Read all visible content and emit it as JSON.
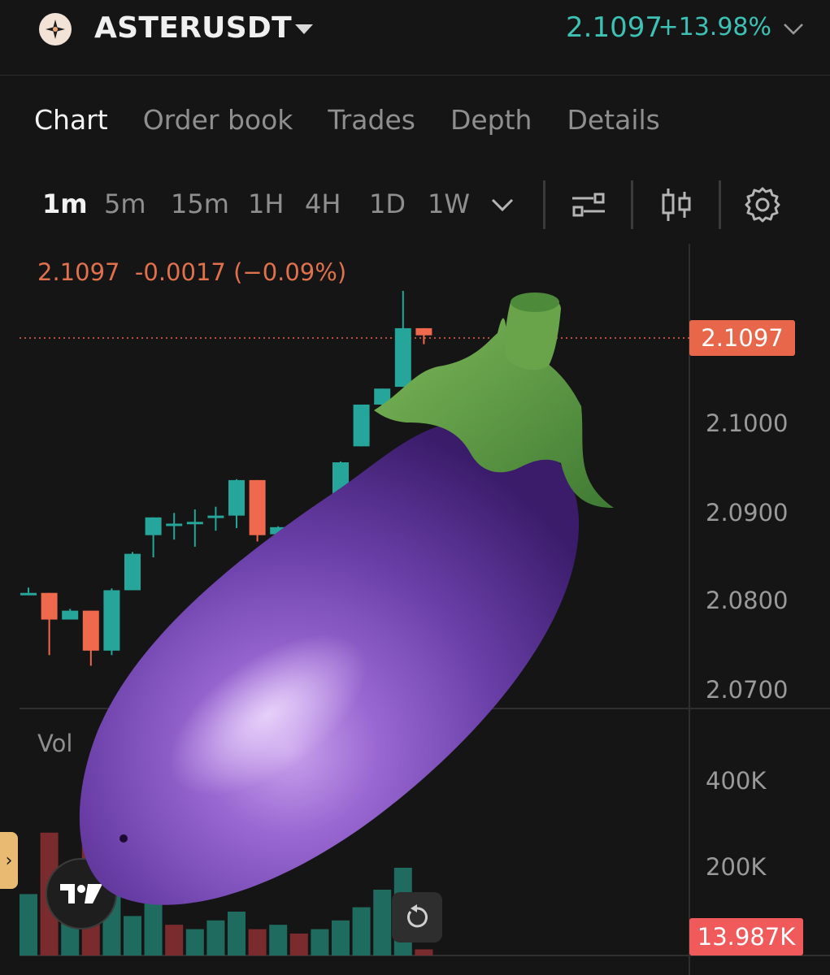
{
  "header": {
    "pair": "ASTERUSDT",
    "price": "2.1097",
    "change": "+13.98%"
  },
  "tabs": [
    "Chart",
    "Order book",
    "Trades",
    "Depth",
    "Details"
  ],
  "intervals": [
    "1m",
    "5m",
    "15m",
    "1H",
    "4H",
    "1D",
    "1W"
  ],
  "chart": {
    "ohlc_price": "2.1097",
    "ohlc_change": "-0.0017 (−0.09%)",
    "last_price_tag": "2.1097",
    "y_ticks": [
      "2.1000",
      "2.0900",
      "2.0800",
      "2.0700"
    ],
    "volume_label": "Vol",
    "volume_ticks": [
      "400K",
      "200K"
    ],
    "volume_tag": "13.987K"
  },
  "colors": {
    "up": "#26a69a",
    "down": "#ef6a4c",
    "accent_teal": "#3ec1b5"
  },
  "icons": {
    "logo": "aster-logo",
    "caret": "caret-down-icon",
    "indicators": "indicators-icon",
    "candles": "candlestick-icon",
    "settings": "gear-icon",
    "tradingview": "tradingview-logo",
    "reset": "reset-icon",
    "overlay": "eggplant-emoji"
  },
  "chart_data": {
    "type": "candlestick",
    "interval": "1m",
    "candles": [
      {
        "o": 2.081,
        "h": 2.0816,
        "l": 2.081,
        "c": 2.081
      },
      {
        "o": 2.081,
        "h": 2.081,
        "l": 2.074,
        "c": 2.078
      },
      {
        "o": 2.078,
        "h": 2.0792,
        "l": 2.078,
        "c": 2.079
      },
      {
        "o": 2.079,
        "h": 2.079,
        "l": 2.0728,
        "c": 2.0745
      },
      {
        "o": 2.0745,
        "h": 2.0815,
        "l": 2.074,
        "c": 2.0813
      },
      {
        "o": 2.0813,
        "h": 2.0856,
        "l": 2.0813,
        "c": 2.0854
      },
      {
        "o": 2.0875,
        "h": 2.0895,
        "l": 2.085,
        "c": 2.0895
      },
      {
        "o": 2.0886,
        "h": 2.09,
        "l": 2.087,
        "c": 2.0888
      },
      {
        "o": 2.0888,
        "h": 2.0904,
        "l": 2.0862,
        "c": 2.089
      },
      {
        "o": 2.0897,
        "h": 2.0907,
        "l": 2.088,
        "c": 2.0897
      },
      {
        "o": 2.0897,
        "h": 2.0938,
        "l": 2.0883,
        "c": 2.0937
      },
      {
        "o": 2.0937,
        "h": 2.0937,
        "l": 2.0868,
        "c": 2.0875
      },
      {
        "o": 2.0876,
        "h": 2.0885,
        "l": 2.0864,
        "c": 2.0884
      },
      {
        "o": 2.088,
        "h": 2.0894,
        "l": 2.0866,
        "c": 2.0882
      },
      {
        "o": 2.0878,
        "h": 2.0906,
        "l": 2.0877,
        "c": 2.09
      },
      {
        "o": 2.09,
        "h": 2.0958,
        "l": 2.09,
        "c": 2.0957
      },
      {
        "o": 2.0975,
        "h": 2.1022,
        "l": 2.0975,
        "c": 2.1022
      },
      {
        "o": 2.1022,
        "h": 2.104,
        "l": 2.1012,
        "c": 2.104
      },
      {
        "o": 2.1042,
        "h": 2.115,
        "l": 2.1042,
        "c": 2.1108
      },
      {
        "o": 2.1108,
        "h": 2.1108,
        "l": 2.109,
        "c": 2.11
      }
    ],
    "volume": [
      {
        "v": 140000,
        "dir": "up"
      },
      {
        "v": 280000,
        "dir": "down"
      },
      {
        "v": 180000,
        "dir": "up"
      },
      {
        "v": 260000,
        "dir": "down"
      },
      {
        "v": 150000,
        "dir": "up"
      },
      {
        "v": 90000,
        "dir": "up"
      },
      {
        "v": 120000,
        "dir": "up"
      },
      {
        "v": 70000,
        "dir": "down"
      },
      {
        "v": 60000,
        "dir": "up"
      },
      {
        "v": 80000,
        "dir": "up"
      },
      {
        "v": 100000,
        "dir": "up"
      },
      {
        "v": 60000,
        "dir": "down"
      },
      {
        "v": 70000,
        "dir": "up"
      },
      {
        "v": 50000,
        "dir": "down"
      },
      {
        "v": 60000,
        "dir": "up"
      },
      {
        "v": 80000,
        "dir": "up"
      },
      {
        "v": 110000,
        "dir": "up"
      },
      {
        "v": 150000,
        "dir": "up"
      },
      {
        "v": 200000,
        "dir": "up"
      },
      {
        "v": 13987,
        "dir": "down"
      }
    ],
    "price_axis_ticks": [
      2.1,
      2.09,
      2.08,
      2.07
    ],
    "last_price": 2.1097,
    "volume_axis_ticks": [
      400000,
      200000
    ]
  }
}
